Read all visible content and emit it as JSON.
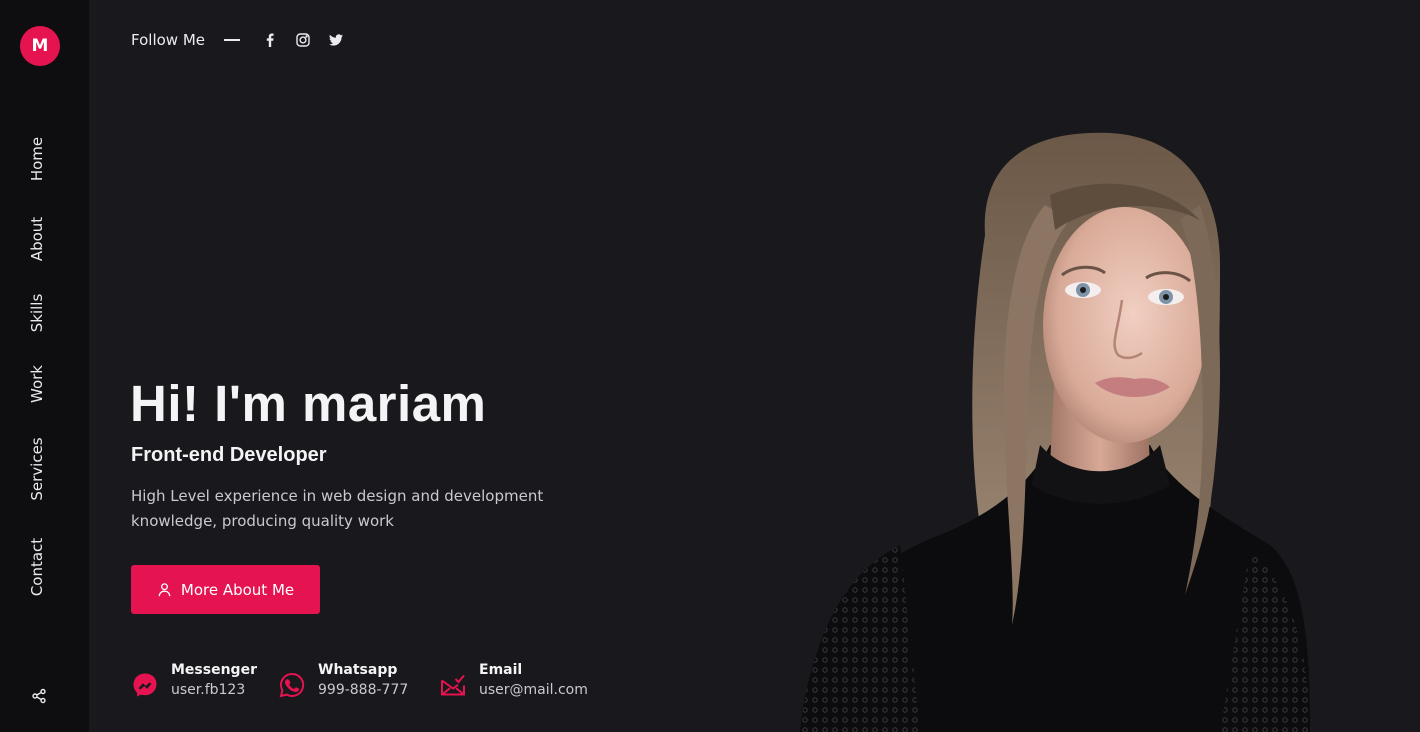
{
  "logo": {
    "letter": "M"
  },
  "nav": [
    {
      "label": "Home"
    },
    {
      "label": "About"
    },
    {
      "label": "Skills"
    },
    {
      "label": "Work"
    },
    {
      "label": "Services"
    },
    {
      "label": "Contact"
    }
  ],
  "social": {
    "label": "Follow Me",
    "icons": [
      "facebook-icon",
      "instagram-icon",
      "twitter-icon"
    ]
  },
  "hero": {
    "title": "Hi! I'm mariam",
    "subtitle": "Front-end Developer",
    "description": "High Level experience in web design and development knowledge, producing quality work",
    "cta_label": "More About Me"
  },
  "contacts": [
    {
      "title": "Messenger",
      "value": "user.fb123",
      "icon": "messenger-icon"
    },
    {
      "title": "Whatsapp",
      "value": "999-888-777",
      "icon": "whatsapp-icon"
    },
    {
      "title": "Email",
      "value": "user@mail.com",
      "icon": "email-icon"
    }
  ],
  "colors": {
    "accent": "#e5134f",
    "background": "#18181d",
    "sidebar": "#0e0e11"
  }
}
